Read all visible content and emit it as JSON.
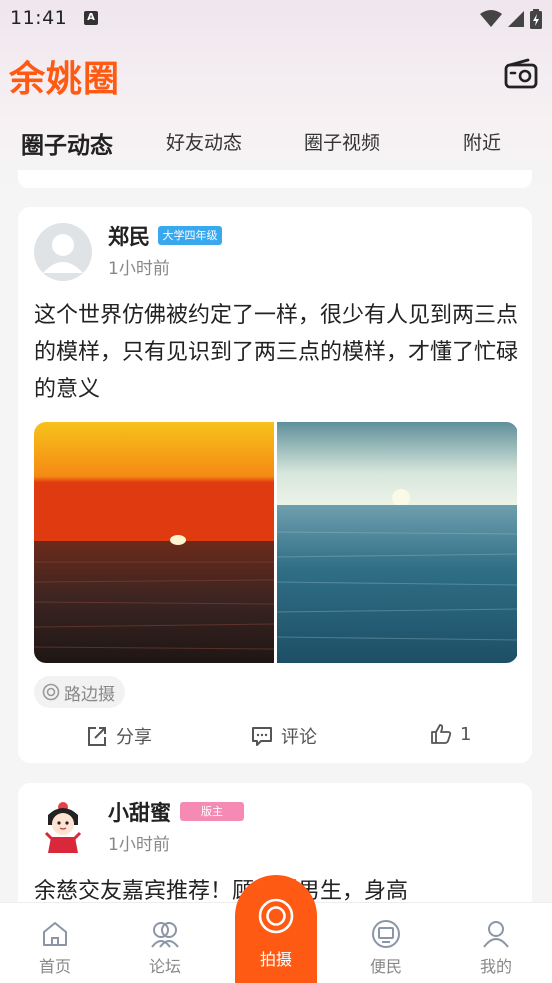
{
  "status": {
    "time": "11:41",
    "notif_icon": "A"
  },
  "app": {
    "title": "余姚圈"
  },
  "tabs": [
    {
      "label": "圈子动态",
      "active": true
    },
    {
      "label": "好友动态"
    },
    {
      "label": "圈子视频"
    },
    {
      "label": "附近"
    }
  ],
  "posts": [
    {
      "username": "郑民",
      "badge": "大学四年级",
      "badge_color": "#3aa8ee",
      "time": "1小时前",
      "text": "这个世界仿佛被约定了一样，很少有人见到两三点的模样，只有见识到了两三点的模样，才懂了忙碌的意义",
      "tag": "路边摄",
      "actions": {
        "share": "分享",
        "comment": "评论",
        "like_count": "1"
      }
    },
    {
      "username": "小甜蜜",
      "badge": "版主",
      "badge_color": "#f58bb4",
      "time": "1小时前",
      "text": "余慈交友嘉宾推荐！顾家型男生，身高"
    }
  ],
  "nav": {
    "home": "首页",
    "forum": "论坛",
    "shoot": "拍摄",
    "service": "便民",
    "mine": "我的"
  },
  "colors": {
    "accent": "#ff5a14"
  }
}
